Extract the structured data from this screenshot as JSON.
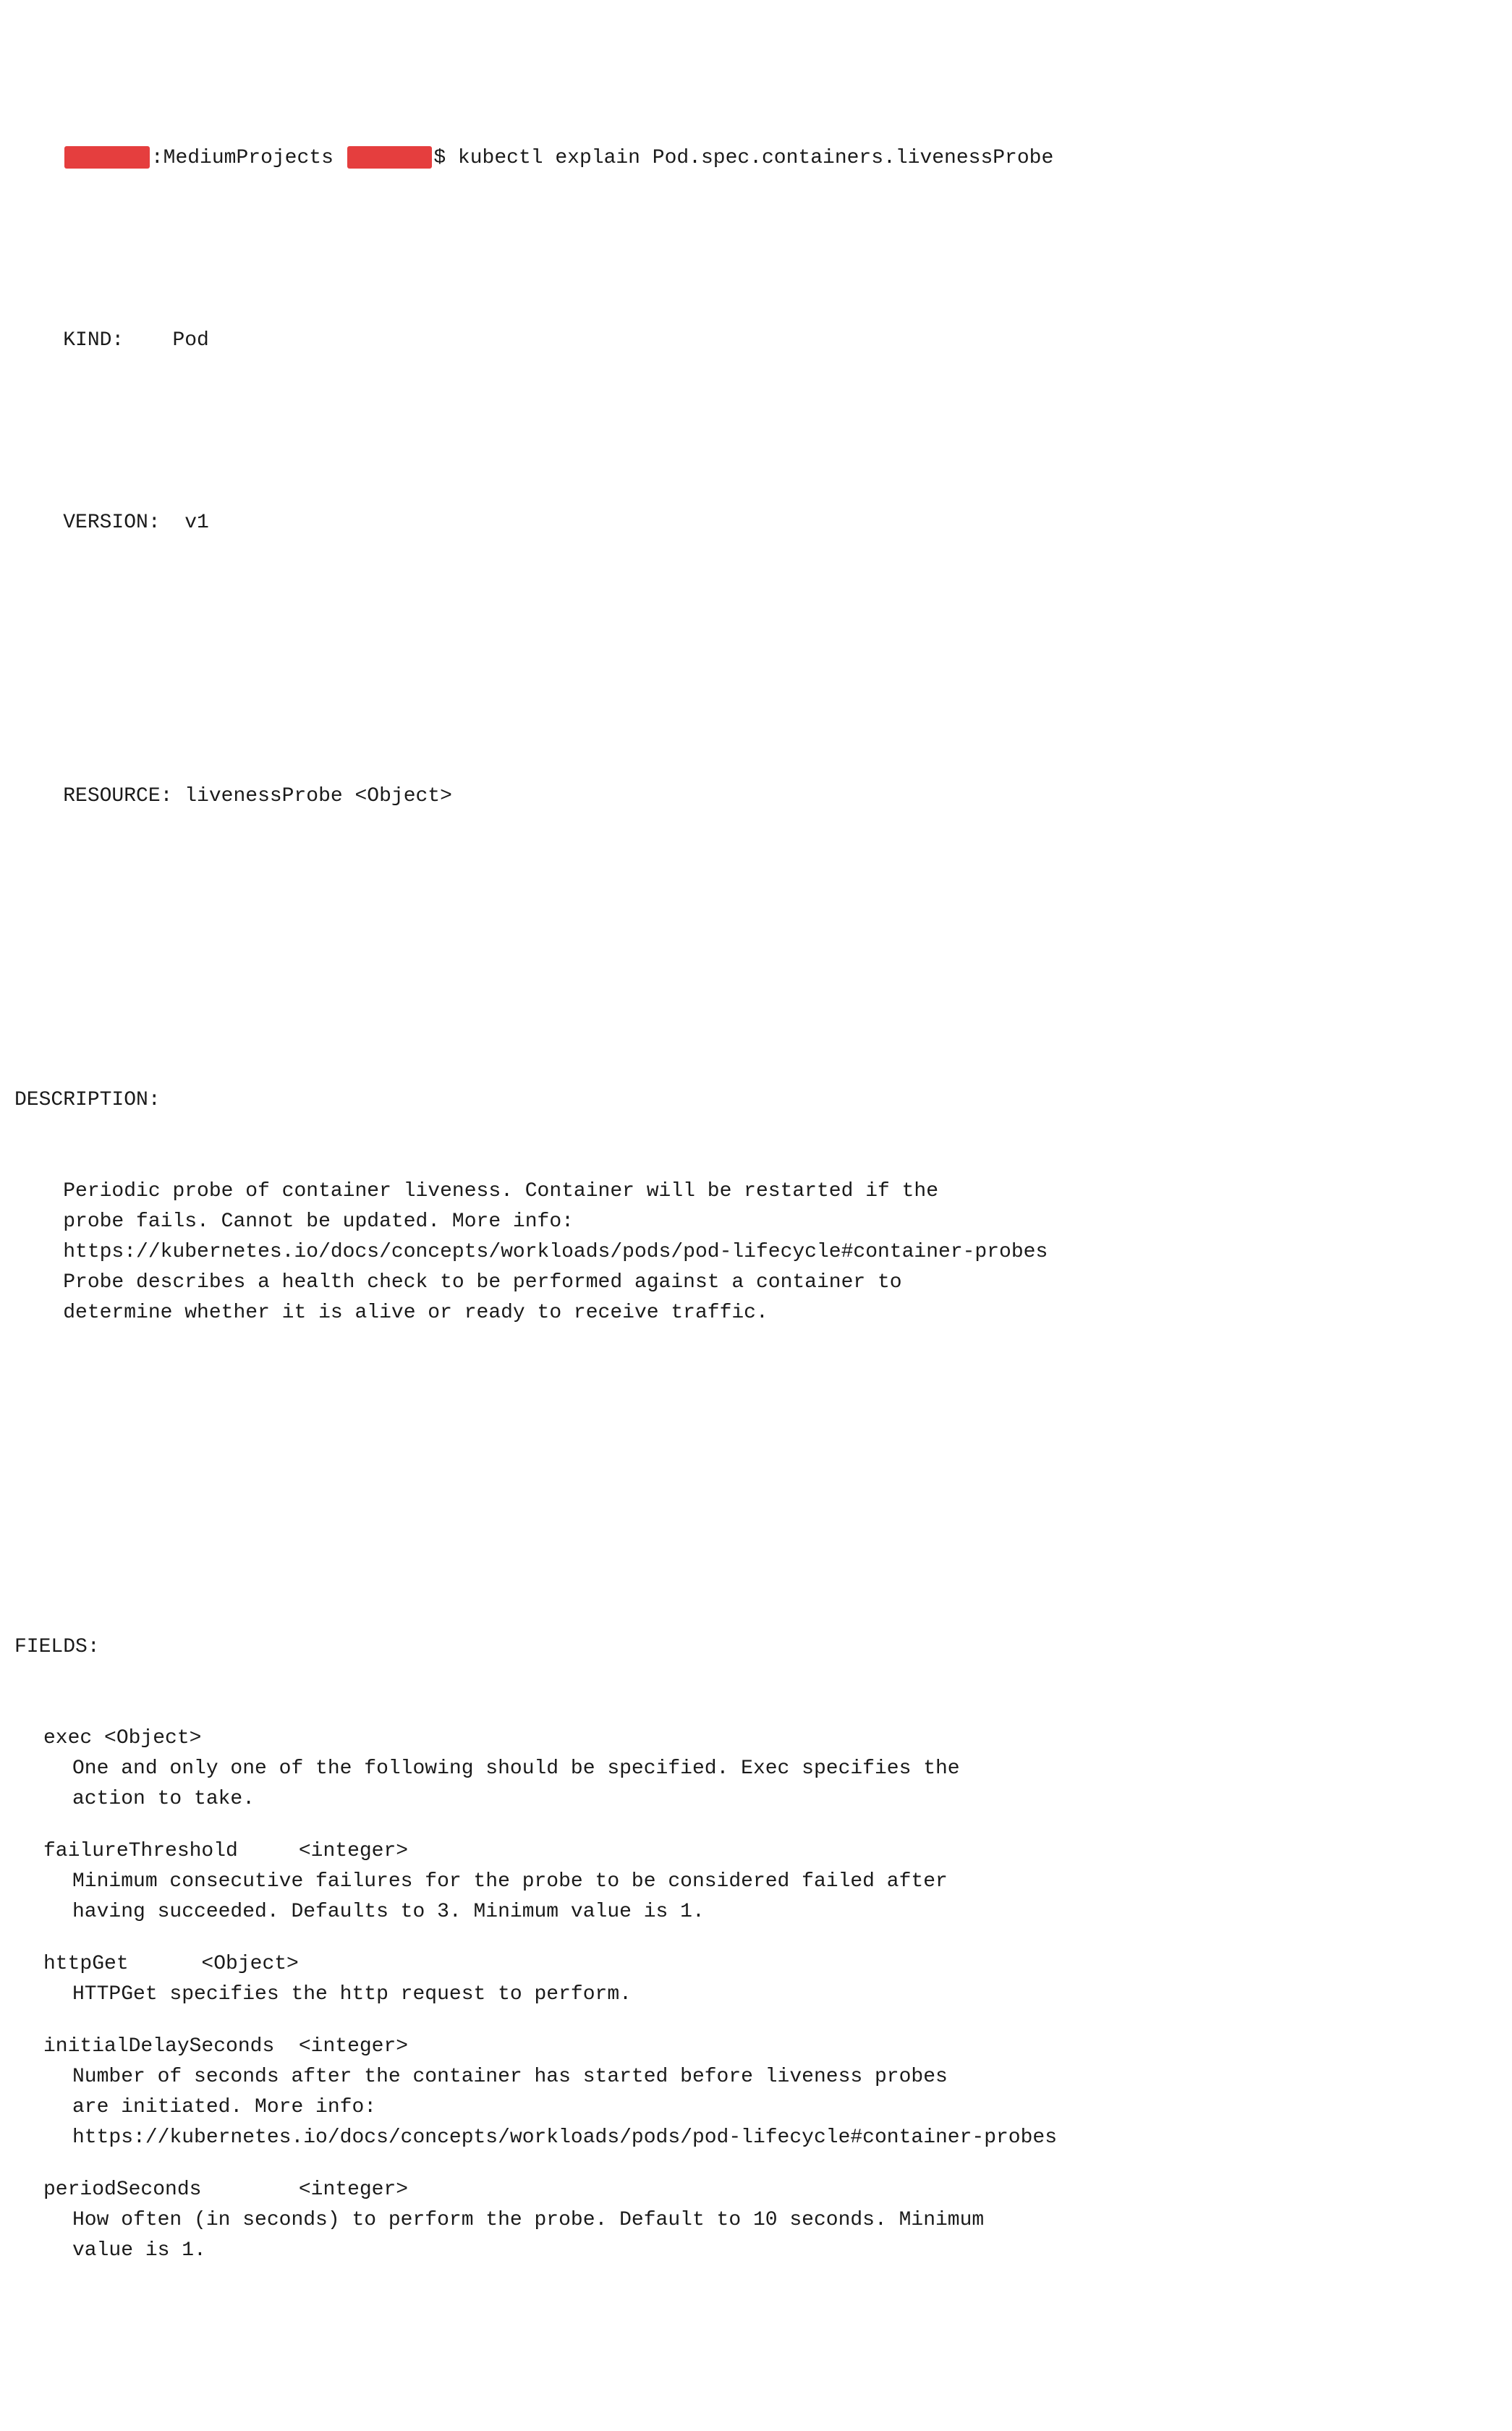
{
  "terminal": {
    "prompt_line": ":MediumProjects",
    "command": "$ kubectl explain Pod.spec.containers.livenessProbe",
    "kind_label": "KIND:",
    "kind_value": "    Pod",
    "version_label": "VERSION:",
    "version_value": "  v1",
    "resource_label": "RESOURCE:",
    "resource_value": " livenessProbe <Object>",
    "description_label": "DESCRIPTION:",
    "description_lines": [
      "    Periodic probe of container liveness. Container will be restarted if the",
      "    probe fails. Cannot be updated. More info:",
      "    https://kubernetes.io/docs/concepts/workloads/pods/pod-lifecycle#container-probes",
      "",
      "    Probe describes a health check to be performed against a container to",
      "    determine whether it is alive or ready to receive traffic."
    ],
    "fields_label": "FIELDS:",
    "fields": [
      {
        "name": "exec <Object>",
        "description": "    One and only one of the following should be specified. Exec specifies the\n    action to take."
      },
      {
        "name": "failureThreshold     <integer>",
        "description": "    Minimum consecutive failures for the probe to be considered failed after\n    having succeeded. Defaults to 3. Minimum value is 1."
      },
      {
        "name": "httpGet      <Object>",
        "description": "    HTTPGet specifies the http request to perform."
      },
      {
        "name": "initialDelaySeconds  <integer>",
        "description": "    Number of seconds after the container has started before liveness probes\n    are initiated. More info:\n    https://kubernetes.io/docs/concepts/workloads/pods/pod-lifecycle#container-probes"
      },
      {
        "name": "periodSeconds        <integer>",
        "description": "    How often (in seconds) to perform the probe. Default to 10 seconds. Minimum\n    value is 1."
      }
    ]
  }
}
